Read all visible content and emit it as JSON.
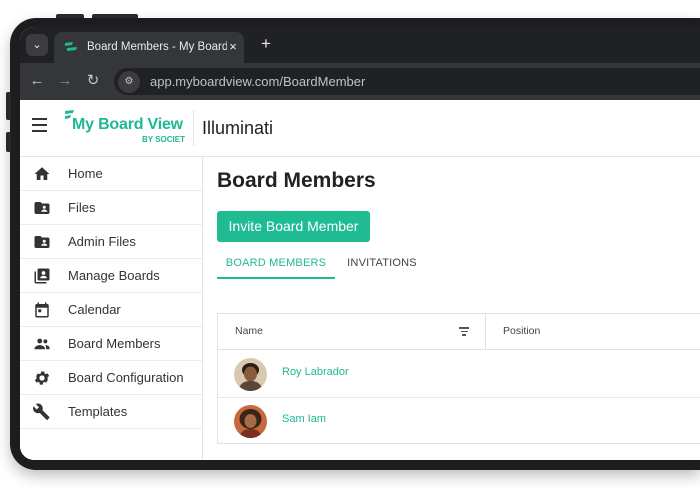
{
  "browser": {
    "tab_title": "Board Members - My Board View",
    "tab_close": "×",
    "new_tab": "+",
    "url": "app.myboardview.com/BoardMember"
  },
  "header": {
    "logo_text": "My Board View",
    "logo_sub": "BY SOCIET",
    "org_name": "Illuminati"
  },
  "sidebar": {
    "items": [
      {
        "label": "Home",
        "icon": "home-icon"
      },
      {
        "label": "Files",
        "icon": "folder-shared-icon"
      },
      {
        "label": "Admin Files",
        "icon": "folder-shared-icon"
      },
      {
        "label": "Manage Boards",
        "icon": "contacts-icon"
      },
      {
        "label": "Calendar",
        "icon": "calendar-icon"
      },
      {
        "label": "Board Members",
        "icon": "people-icon"
      },
      {
        "label": "Board Configuration",
        "icon": "gear-icon"
      },
      {
        "label": "Templates",
        "icon": "tools-icon"
      }
    ]
  },
  "main": {
    "title": "Board Members",
    "invite_label": "Invite Board Member",
    "tabs": [
      {
        "label": "BOARD MEMBERS",
        "active": true
      },
      {
        "label": "INVITATIONS",
        "active": false
      }
    ],
    "table": {
      "columns": [
        "Name",
        "Position"
      ],
      "rows": [
        {
          "name": "Roy Labrador"
        },
        {
          "name": "Sam Iam"
        }
      ]
    }
  },
  "colors": {
    "accent": "#1fbc94",
    "browser_dark": "#202124"
  }
}
